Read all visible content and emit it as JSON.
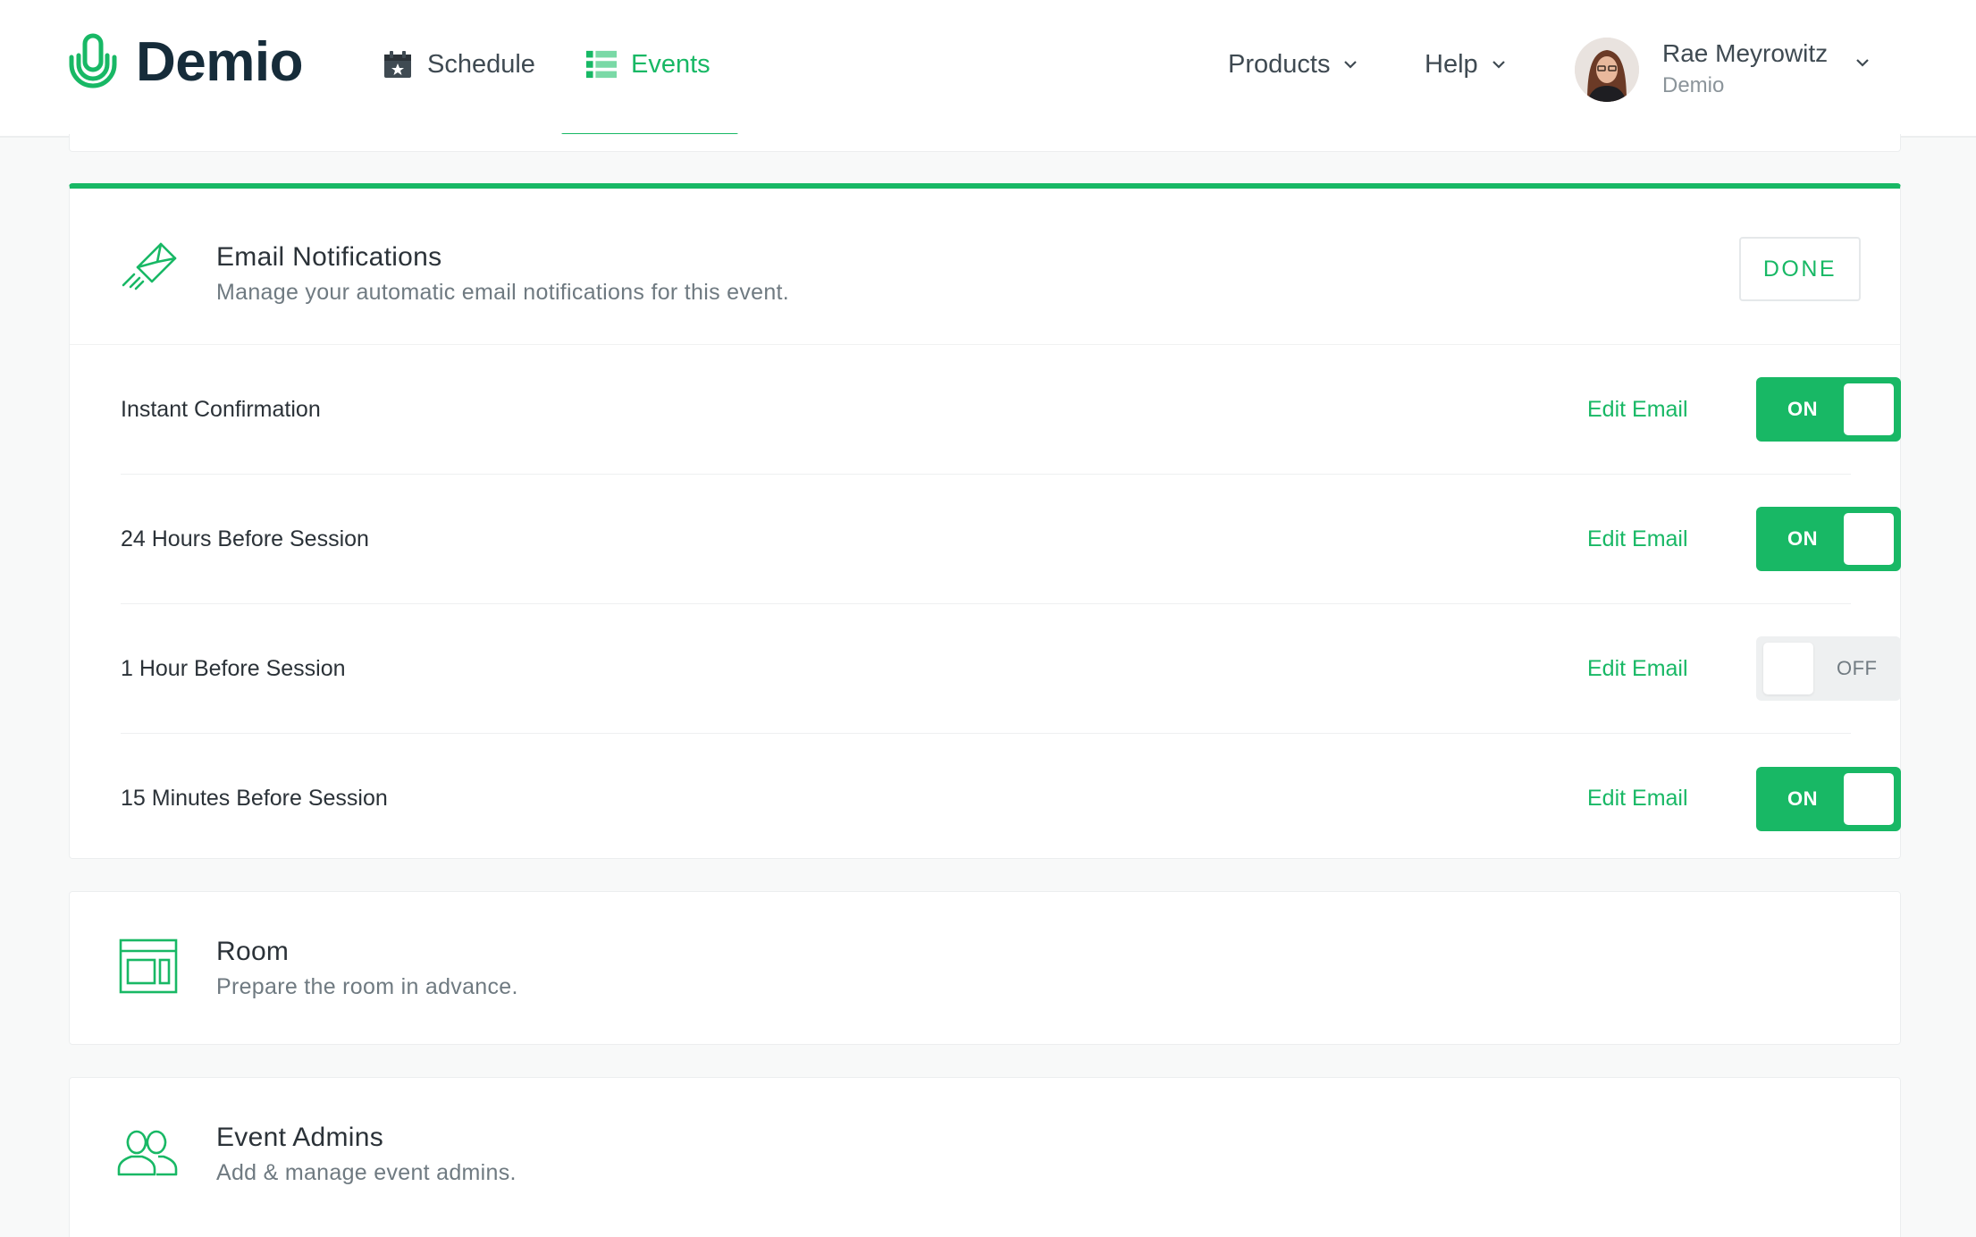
{
  "brand": {
    "name": "Demio",
    "accent": "#18b865",
    "dark": "#162c3a"
  },
  "nav": {
    "schedule": {
      "label": "Schedule",
      "icon": "calendar-star-icon"
    },
    "events": {
      "label": "Events",
      "icon": "list-icon",
      "active": true
    },
    "products": {
      "label": "Products",
      "icon": "chevron-down-icon"
    },
    "help": {
      "label": "Help",
      "icon": "chevron-down-icon"
    }
  },
  "user": {
    "name": "Rae Meyrowitz",
    "org": "Demio"
  },
  "email_notifications": {
    "title": "Email Notifications",
    "subtitle": "Manage your automatic email notifications for this event.",
    "done_label": "DONE",
    "items": [
      {
        "label": "Instant Confirmation",
        "edit_label": "Edit Email",
        "state": "ON"
      },
      {
        "label": "24 Hours Before Session",
        "edit_label": "Edit Email",
        "state": "ON"
      },
      {
        "label": "1 Hour Before Session",
        "edit_label": "Edit Email",
        "state": "OFF"
      },
      {
        "label": "15 Minutes Before Session",
        "edit_label": "Edit Email",
        "state": "ON"
      }
    ]
  },
  "room": {
    "title": "Room",
    "subtitle": "Prepare the room in advance."
  },
  "admins": {
    "title": "Event Admins",
    "subtitle": "Add & manage event admins."
  }
}
